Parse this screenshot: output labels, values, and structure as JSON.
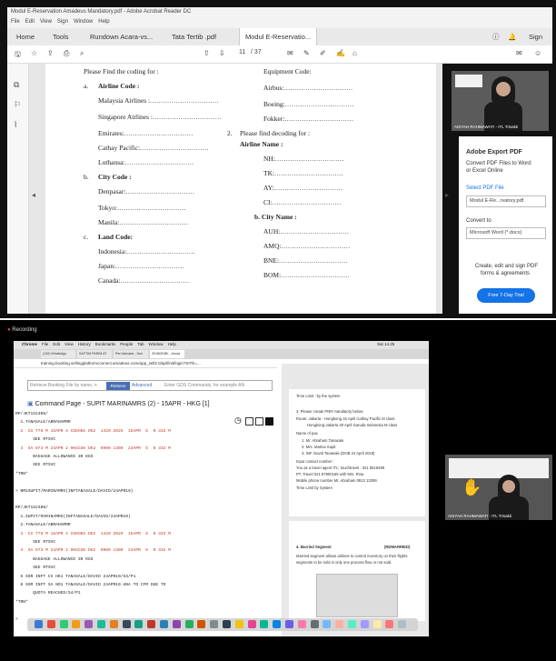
{
  "top": {
    "window_title": "Modul E-Reservation Amadeus Mandatory.pdf - Adobe Acrobat Reader DC",
    "menu": [
      "File",
      "Edit",
      "View",
      "Sign",
      "Window",
      "Help"
    ],
    "tabs": [
      "Home",
      "Tools",
      "Rundown Acara-vs...",
      "Tata Tertib .pdf",
      "Modul E-Reservatio..."
    ],
    "sign_in": "Sign In",
    "page_num": "11",
    "page_total": "/ 37",
    "doc": {
      "heading_left": "Please Find the coding for :",
      "heading_right": "Equipment Code:",
      "a_label": "a.",
      "airline_code": "Airline Code :",
      "airlines": [
        "Malaysia Airlines :",
        "Singapore Airlines :",
        "Emirates:",
        "Cathay Pacific:",
        "Luthansa:"
      ],
      "b_label": "b.",
      "city_code": "City Code :",
      "cities": [
        "Denpasar:",
        "Tokyo:",
        "Manila:"
      ],
      "c_label": "c.",
      "land_code": "Land Code:",
      "lands": [
        "Indonesia:",
        "Japan:",
        "Canada:"
      ],
      "equipment": [
        "Airbus:",
        "Boeing:",
        "Fokker:"
      ],
      "decoding_num": "2.",
      "decoding": "Please find decoding for :",
      "airline_name": "Airline Name :",
      "codes_airline": [
        "NH:",
        "TK:",
        "AY:",
        "CI:"
      ],
      "city_name": "City Name :",
      "codes_city": [
        "AUH:",
        "AMQ:",
        "BNE:",
        "BOM:"
      ],
      "dots": "................................"
    },
    "right_pane": {
      "export_title": "Adobe Export PDF",
      "export_desc1": "Convert PDF Files to Word",
      "export_desc2": "or Excel Online",
      "select_label": "Select PDF File",
      "file_value": "Modul E-Re...rvatory.pdf",
      "convert_to": "Convert to",
      "convert_value": "Microsoft Word (*.docx)",
      "promo1": "Create, edit and sign PDF",
      "promo2": "forms & agreements",
      "trial": "Free 7-Day Trial"
    },
    "video_name": "AISYAH RAHMAWATI - ITL Trisakti"
  },
  "bottom": {
    "recording": "Recording",
    "mac_menu": [
      "Chrome",
      "File",
      "Edit",
      "View",
      "History",
      "Bookmarks",
      "People",
      "Tab",
      "Window",
      "Help"
    ],
    "mac_status": "Sat 14.26",
    "browser_tabs": [
      "(132) WhatsApp",
      "SAFTIM PARIM AT",
      "Peri Akmade - Don",
      "ZK98OKBK - Amad"
    ],
    "address": "training.booking.sellingplatformconnect.amadeus.com/app_sell2.0/apf/init/login?SITE=...",
    "cmd_placeholder": "Retrieve Booking File by name, n",
    "retrieve_btn": "Retrieve",
    "advanced": "Advanced",
    "gds_placeholder": "Enter GDS Commands, for example AN",
    "cmd_title": "Command Page - SUPIT MARINAMRS (2) - 15APR - HKG [1]",
    "terminal_lines": [
      "RP/JKT1S2308/",
      "  1.TANASALE/ABRAHAMMR",
      "  2  CX 776 M 15APR 4 CGKHKG DK2  1420 2025  15APR  E  0 333 M",
      "       SEE RTSVC",
      "  3  SA 873 M 23APR 2 HKGCGK DK2  0900 1300  23APR  E  0 332 M",
      "       BAGGAGE ALLOWANCE 30 KGS",
      "       SEE RTSVC",
      "*TRN*",
      "",
      "> NM1SUPIT/MARINAMRS(INFTANASALE/DAVID/24APR19)",
      "",
      "RP/JKT1S2308/",
      "  1.SUPIT/MARINAMRS(INFTANASALE/DAVID/24APR19)",
      "  2.TANASALE/ABRAHAMMR",
      "  3  CX 776 M 15APR 4 CGKHKG DK2  1420 2025  15APR  E  0 333 M",
      "       SEE RTSVC",
      "  4  SA 873 M 23APR 2 HKGCGK DK2  0900 1300  23APR  E  0 332 M",
      "       BAGGAGE ALLOWANCE 30 KGS",
      "       SEE RTSVC",
      "  5 SSR INFT CX HK1 TANASALE/DAVID 24APR19/S3/P1",
      "  6 SSR INFT SA NO1 TANASALE/DAVID 24APR19.UNA TO CFM DUE TO",
      "       QUOTA REACHED/S4/P1",
      "*TRN*",
      "",
      ">"
    ],
    "rdoc": {
      "line1": "Time Limit : by the system",
      "line2": "3. Please create PNR mandatory below:",
      "line3": "Route: Jakarta - Hongkong 15 April Cathay Pacific M class",
      "line4": "Hongkong-Jakarta 30 April Garuda Indonesia M class",
      "line5": "Name of pax",
      "line6": "1. Mr. Abraham Tanasale",
      "line7": "2. Mrs. Marina Supit",
      "line8": "3. INF. David Tanasale (DOB 24 April 2019)",
      "line9": "Input contact number :",
      "line10": "You as a travel agent ITL: touchtravel : 021 8518499",
      "line11": "PT. Travel 021 87800165 with Mrs. Rina",
      "line12": "Mobile phone number Mr. Abraham 0813 13299",
      "line13": "Time Limit by System",
      "sec_title": "4. Married Segment",
      "sec_tag": "(RDMARRIED)",
      "p1": "Married segment allows airlines to control inventory on their flights",
      "p2": "segments to be sold in only one process flow or not sold."
    },
    "video_name": "AISYAH RAHMAWATI - ITL Trisakti"
  }
}
